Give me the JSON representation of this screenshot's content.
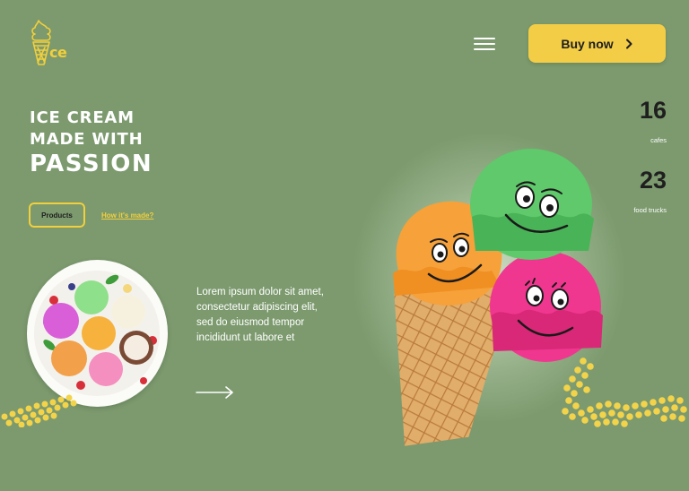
{
  "header": {
    "logo_text": "ce",
    "buy_label": "Buy now"
  },
  "hero": {
    "line1": "ICE CREAM",
    "line2": "MADE WITH",
    "line3": "PASSION",
    "products_label": "Products",
    "how_link": "How it's made?",
    "description": "Lorem ipsum dolor sit amet, consectetur adipiscing elit, sed do eiusmod tempor incididunt ut labore et"
  },
  "stats": [
    {
      "value": "16",
      "label": "cafes"
    },
    {
      "value": "23",
      "label": "food trucks"
    }
  ],
  "colors": {
    "background": "#7c9a6e",
    "accent": "#f3cd46",
    "scoop_green": "#5fc96b",
    "scoop_orange": "#f7a23a",
    "scoop_pink": "#f0378f"
  },
  "icons": {
    "logo": "ice-cream-cone-icon",
    "menu": "hamburger-menu-icon",
    "buy": "chevron-right-icon",
    "arrow": "arrow-right-icon"
  }
}
